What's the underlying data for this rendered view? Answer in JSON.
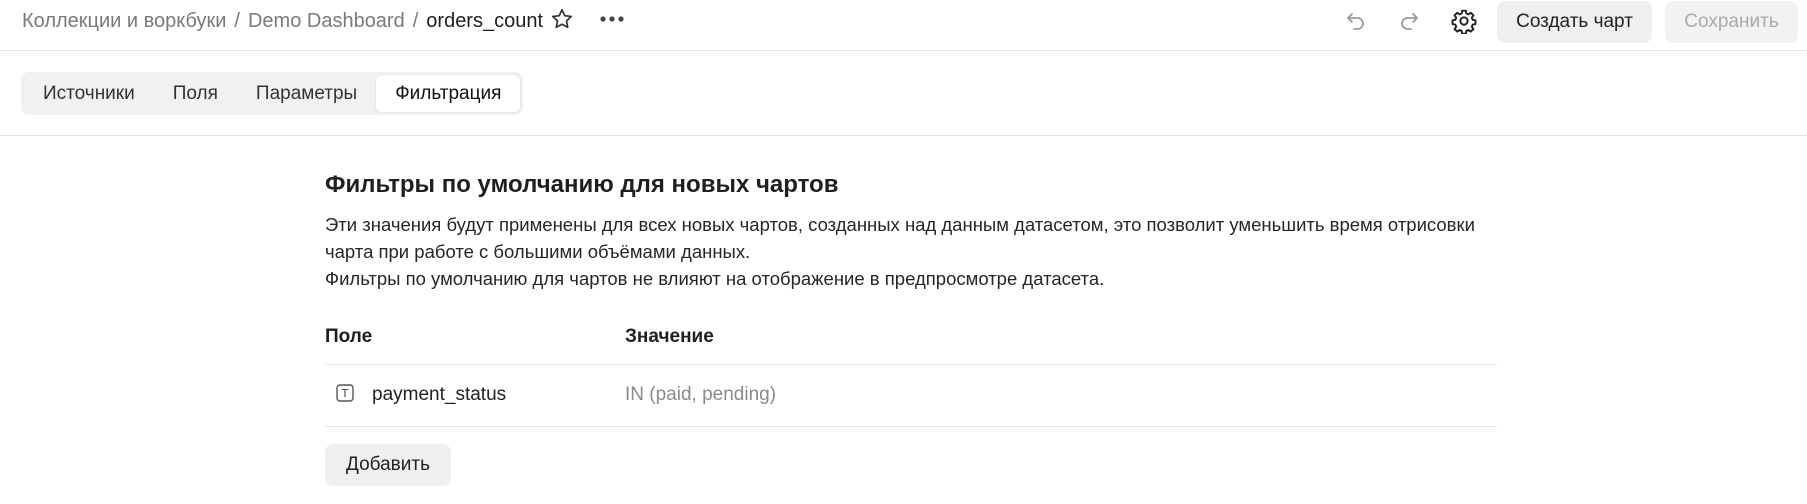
{
  "header": {
    "breadcrumbs": [
      {
        "label": "Коллекции и воркбуки"
      },
      {
        "label": "Demo Dashboard"
      },
      {
        "label": "orders_count"
      }
    ],
    "separator": "/",
    "icons": {
      "favorite": "star-icon",
      "more": "more-horizontal-icon",
      "undo": "undo-icon",
      "redo": "redo-icon",
      "settings": "gear-icon"
    },
    "create_chart_label": "Создать чарт",
    "save_label": "Сохранить"
  },
  "tabs": [
    {
      "label": "Источники",
      "active": false
    },
    {
      "label": "Поля",
      "active": false
    },
    {
      "label": "Параметры",
      "active": false
    },
    {
      "label": "Фильтрация",
      "active": true
    }
  ],
  "main": {
    "title": "Фильтры по умолчанию для новых чартов",
    "description_line1": "Эти значения будут применены для всех новых чартов, созданных над данным датасетом, это позволит уменьшить время отрисовки чарта при работе с большими объёмами данных.",
    "description_line2": "Фильтры по умолчанию для чартов не влияют на отображение в предпросмотре датасета.",
    "table": {
      "columns": [
        "Поле",
        "Значение"
      ],
      "rows": [
        {
          "type_icon": "text-type-icon",
          "type_letter": "T",
          "field": "payment_status",
          "value": "IN (paid, pending)"
        }
      ]
    },
    "add_label": "Добавить"
  },
  "colors": {
    "text": "#222222",
    "muted": "#7a7a7a",
    "button_bg": "#efefef",
    "disabled_text": "#aaaaaa",
    "divider": "#e5e5e5"
  }
}
